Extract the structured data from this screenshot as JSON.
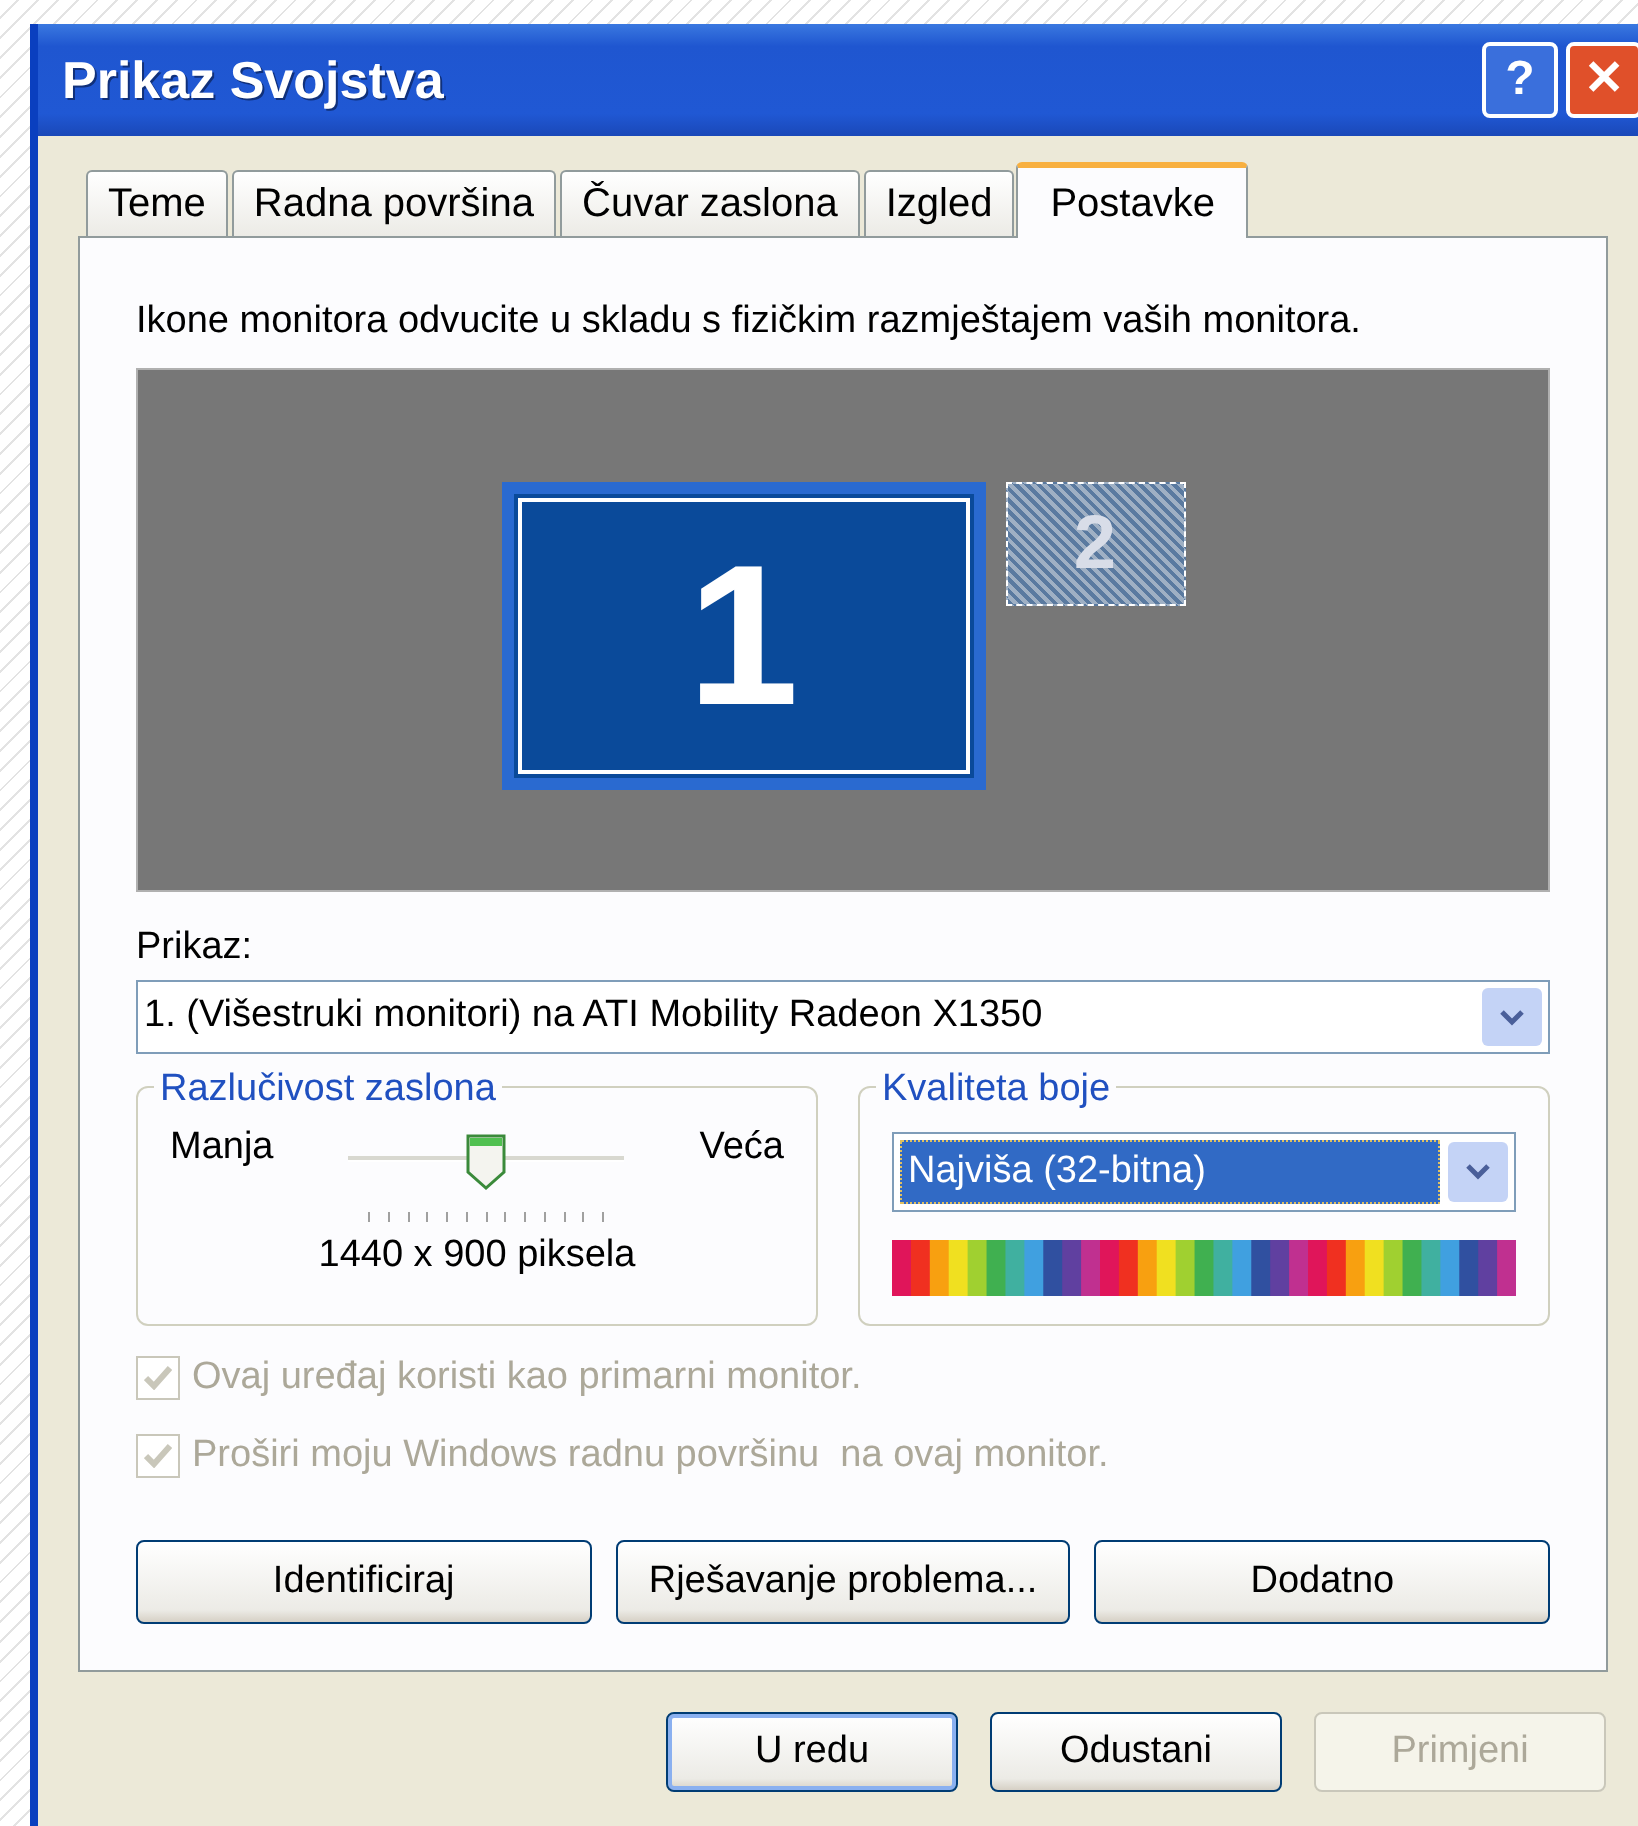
{
  "window": {
    "title": "Prikaz Svojstva",
    "buttons": [
      {
        "kind": "help",
        "label": "?"
      },
      {
        "kind": "close",
        "label": "✕"
      }
    ]
  },
  "tabs": [
    {
      "label": "Teme",
      "selected": false
    },
    {
      "label": "Radna površina",
      "selected": false
    },
    {
      "label": "Čuvar zaslona",
      "selected": false
    },
    {
      "label": "Izgled",
      "selected": false
    },
    {
      "label": "Postavke",
      "selected": true
    }
  ],
  "instruction": "Ikone monitora odvucite u skladu s fizičkim razmještajem vaših monitora.",
  "monitors": [
    {
      "label": "1",
      "selected": true
    },
    {
      "label": "2",
      "selected": false
    }
  ],
  "display": {
    "label": "Prikaz:",
    "value": "1. (Višestruki monitori) na ATI Mobility Radeon X1350"
  },
  "resolution": {
    "title": "Razlučivost zaslona",
    "min_label": "Manja",
    "max_label": "Veća",
    "level": 0.5,
    "reading": "1440 x 900 piksela"
  },
  "color_quality": {
    "title": "Kvaliteta boje",
    "value": "Najviša (32-bitna)"
  },
  "checkboxes": [
    {
      "label": "Ovaj uređaj koristi kao primarni monitor.",
      "checked": true,
      "disabled": true
    },
    {
      "label": "Proširi moju Windows radnu površinu  na ovaj monitor.",
      "checked": true,
      "disabled": true
    }
  ],
  "panel_buttons": [
    {
      "label": "Identificiraj"
    },
    {
      "label": "Rješavanje problema..."
    },
    {
      "label": "Dodatno"
    }
  ],
  "dialog_buttons": [
    {
      "label": "U redu",
      "disabled": false,
      "default": true
    },
    {
      "label": "Odustani",
      "disabled": false,
      "default": false
    },
    {
      "label": "Primjeni",
      "disabled": true,
      "default": false
    }
  ]
}
